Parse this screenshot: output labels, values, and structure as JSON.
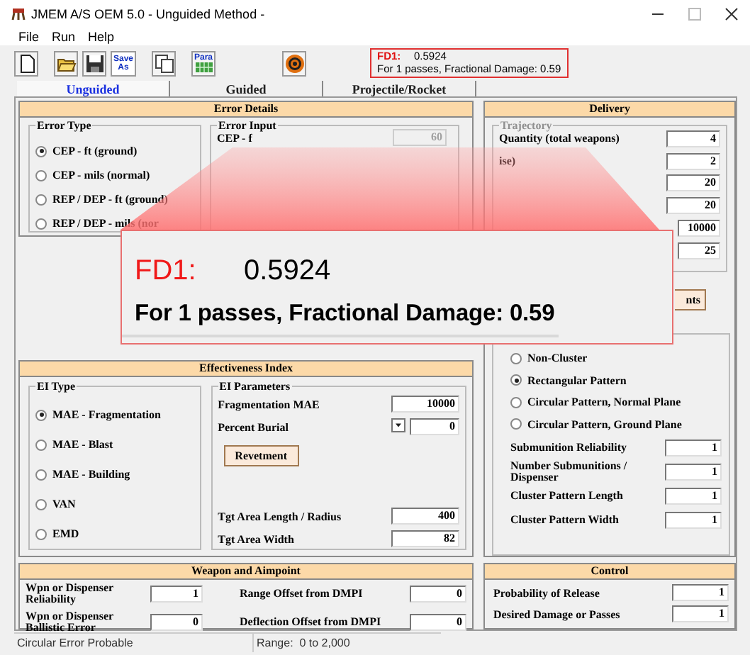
{
  "window": {
    "title": "JMEM A/S OEM 5.0 - Unguided Method -"
  },
  "menu": [
    "File",
    "Run",
    "Help"
  ],
  "toolbar": [
    {
      "kind": "new"
    },
    {
      "kind": "open"
    },
    {
      "kind": "save"
    },
    {
      "kind": "save_as",
      "label": "Save As"
    },
    {
      "kind": "copy"
    },
    {
      "kind": "para",
      "label": "Para"
    },
    {
      "kind": "target"
    }
  ],
  "result": {
    "label": "FD1:",
    "value": "0.5924",
    "summary": "For 1 passes, Fractional Damage: 0.59"
  },
  "tabs": [
    {
      "label": "Unguided",
      "selected": true
    },
    {
      "label": "Guided",
      "selected": false
    },
    {
      "label": "Projectile/Rocket",
      "selected": false
    }
  ],
  "error_details": {
    "title": "Error Details",
    "error_type": {
      "title": "Error Type",
      "options": [
        {
          "label": "CEP - ft (ground)",
          "selected": true
        },
        {
          "label": "CEP - mils (normal)",
          "selected": false
        },
        {
          "label": "REP / DEP - ft (ground)",
          "selected": false
        },
        {
          "label": "REP / DEP - mils (nor",
          "selected": false
        }
      ]
    },
    "error_input": {
      "title": "Error Input",
      "label": "CEP - f",
      "value": "60",
      "disabled": true
    }
  },
  "delivery": {
    "title": "Delivery",
    "trajectory": {
      "title": "Trajectory",
      "disabled": true,
      "rows": [
        {
          "label": "Quantity (total weapons)",
          "value": "4"
        },
        {
          "label": "ise)",
          "value": "2"
        },
        {
          "value": "20"
        },
        {
          "value": "20"
        },
        {
          "value": "10000"
        },
        {
          "value": "25"
        }
      ]
    },
    "button": "nts",
    "cluster": {
      "options": [
        {
          "label": "Non-Cluster",
          "selected": false
        },
        {
          "label": "Rectangular Pattern",
          "selected": true
        },
        {
          "label": "Circular Pattern, Normal Plane",
          "selected": false
        },
        {
          "label": "Circular Pattern, Ground Plane",
          "selected": false
        }
      ],
      "rows": [
        {
          "label": "Submunition Reliability",
          "value": "1"
        },
        {
          "label": "Number Submunitions / Dispenser",
          "value": "1"
        },
        {
          "label": "Cluster Pattern Length",
          "value": "1"
        },
        {
          "label": "Cluster Pattern Width",
          "value": "1"
        }
      ]
    }
  },
  "effectiveness": {
    "title": "Effectiveness Index",
    "ei_type": {
      "title": "EI Type",
      "options": [
        {
          "label": "MAE - Fragmentation",
          "selected": true
        },
        {
          "label": "MAE - Blast",
          "selected": false
        },
        {
          "label": "MAE - Building",
          "selected": false
        },
        {
          "label": "VAN",
          "selected": false
        },
        {
          "label": "EMD",
          "selected": false
        }
      ]
    },
    "ei_parameters": {
      "title": "EI Parameters",
      "rows": [
        {
          "kind": "field",
          "label": "Fragmentation MAE",
          "value": "10000"
        },
        {
          "kind": "dropdown",
          "label": "Percent Burial",
          "value": "0"
        },
        {
          "kind": "button",
          "label": "Revetment"
        },
        {
          "kind": "field",
          "label": "Tgt Area Length / Radius",
          "value": "400"
        },
        {
          "kind": "field",
          "label": "Tgt Area Width",
          "value": "82"
        }
      ]
    }
  },
  "weapon_aimpoint": {
    "title": "Weapon and Aimpoint",
    "rows": [
      {
        "label": "Wpn or Dispenser Reliability",
        "value": "1"
      },
      {
        "label": "Range Offset from DMPI",
        "value": "0"
      },
      {
        "label": "Wpn or Dispenser Ballistic Error",
        "value": "0"
      },
      {
        "label": "Deflection Offset from DMPI",
        "value": "0"
      }
    ]
  },
  "control": {
    "title": "Control",
    "rows": [
      {
        "label": "Probability of Release",
        "value": "1"
      },
      {
        "label": "Desired Damage or Passes",
        "value": "1"
      }
    ]
  },
  "status_bar": [
    "Circular Error Probable",
    "Range:  0 to 2,000"
  ],
  "magnifier": {
    "label": "FD1:",
    "value": "0.5924",
    "summary": "For 1 passes, Fractional Damage: 0.59"
  }
}
